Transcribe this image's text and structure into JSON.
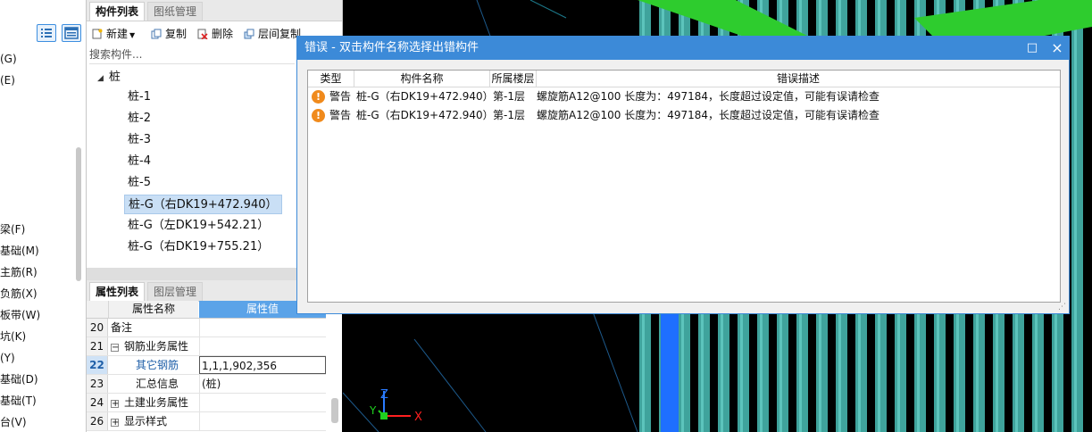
{
  "left_nav": {
    "items_top": [
      "(G)",
      "(E)"
    ],
    "items_bottom": [
      "梁(F)",
      "基础(M)",
      "主筋(R)",
      "负筋(X)",
      "板带(W)",
      "坑(K)",
      "(Y)",
      "基础(D)",
      "基础(T)",
      "台(V)"
    ]
  },
  "component_panel": {
    "tabs": [
      "构件列表",
      "图纸管理"
    ],
    "toolbar": {
      "new": "新建",
      "copy": "复制",
      "delete": "删除",
      "floor_copy": "层间复制"
    },
    "search_placeholder": "搜索构件...",
    "tree_root": "桩",
    "tree_items": [
      "桩-1",
      "桩-2",
      "桩-3",
      "桩-4",
      "桩-5",
      "桩-G（右DK19+472.940）",
      "桩-G（左DK19+542.21）",
      "桩-G（右DK19+755.21）"
    ],
    "selected_index": 5
  },
  "property_panel": {
    "tabs": [
      "属性列表",
      "图层管理"
    ],
    "header": {
      "name": "属性名称",
      "value": "属性值"
    },
    "rows": [
      {
        "num": "20",
        "name": "备注",
        "value": ""
      },
      {
        "num": "21",
        "name": "钢筋业务属性",
        "value": "",
        "expander": "−"
      },
      {
        "num": "22",
        "name": "其它钢筋",
        "value": "1,1,1,902,356"
      },
      {
        "num": "23",
        "name": "汇总信息",
        "value": "(桩)"
      },
      {
        "num": "24",
        "name": "土建业务属性",
        "value": "",
        "expander": "+"
      },
      {
        "num": "26",
        "name": "显示样式",
        "value": "",
        "expander": "+"
      }
    ]
  },
  "viewport": {
    "axis_x": "X",
    "axis_y": "Y",
    "axis_z": "Z"
  },
  "error_dialog": {
    "title": "错误 - 双击构件名称选择出错构件",
    "maximize_icon": "□",
    "close_icon": "×",
    "columns": [
      "类型",
      "构件名称",
      "所属楼层",
      "错误描述"
    ],
    "rows": [
      {
        "type": "警告",
        "component": "桩-G（右DK19+472.940）",
        "floor": "第-1层",
        "description": "螺旋筋A12@100 长度为：497184，长度超过设定值，可能有误请检查"
      },
      {
        "type": "警告",
        "component": "桩-G（右DK19+472.940）",
        "floor": "第-1层",
        "description": "螺旋筋A12@100 长度为：497184，长度超过设定值，可能有误请检查"
      }
    ]
  },
  "colors": {
    "titlebar": "#3c8ad8",
    "pile_fill": "#3fa39c",
    "highlight_green": "#2ecc2e",
    "blue_column": "#1e6fff",
    "warning": "#f08a1c"
  }
}
